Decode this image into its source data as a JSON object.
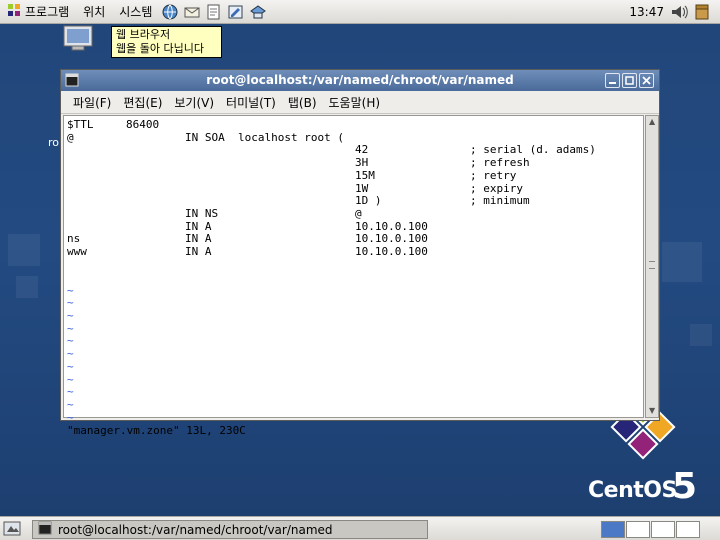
{
  "top_panel": {
    "menus": [
      {
        "label": "프로그램",
        "icon": "applications-menu-icon"
      },
      {
        "label": "위치",
        "icon": ""
      },
      {
        "label": "시스템",
        "icon": ""
      }
    ],
    "launchers": [
      "web-browser-launcher-icon",
      "email-launcher-icon",
      "text-editor-launcher-icon",
      "note-launcher-icon",
      "update-launcher-icon"
    ],
    "clock": "13:47",
    "tray_icons": [
      "volume-icon",
      "software-update-icon"
    ]
  },
  "tooltip": {
    "line1": "웹 브라우저",
    "line2": "웹을 돌아 다닙니다"
  },
  "desktop": {
    "label_stub": "ro",
    "logo_word": "CentOS",
    "logo_version": "5"
  },
  "window": {
    "title": "root@localhost:/var/named/chroot/var/named",
    "menubar": [
      "파일(F)",
      "편집(E)",
      "보기(V)",
      "터미널(T)",
      "탭(B)",
      "도움말(H)"
    ],
    "terminal": {
      "lines": [
        [
          "$TTL",
          "86400",
          "",
          "",
          ""
        ],
        [
          "@",
          "",
          "IN SOA  localhost root (",
          "",
          ""
        ],
        [
          "",
          "",
          "",
          "42",
          "; serial (d. adams)"
        ],
        [
          "",
          "",
          "",
          "3H",
          "; refresh"
        ],
        [
          "",
          "",
          "",
          "15M",
          "; retry"
        ],
        [
          "",
          "",
          "",
          "1W",
          "; expiry"
        ],
        [
          "",
          "",
          "",
          "1D )",
          "; minimum"
        ],
        [
          "",
          "",
          "IN NS",
          "@",
          ""
        ],
        [
          "",
          "",
          "IN A",
          "10.10.0.100",
          ""
        ],
        [
          "ns",
          "",
          "IN A",
          "10.10.0.100",
          ""
        ],
        [
          "www",
          "",
          "IN A",
          "10.10.0.100",
          ""
        ]
      ],
      "tilde": "~",
      "tilde_count": 11,
      "status": "\"manager.vm.zone\" 13L, 230C"
    }
  },
  "bottom_panel": {
    "task_label": "root@localhost:/var/named/chroot/var/named",
    "workspaces": 4,
    "active_workspace": 1
  },
  "colors": {
    "desktop_blue": "#21467a",
    "titlebar_blue": "#5a7aaa",
    "tooltip_yellow": "#ffffbf",
    "tilde_blue": "#3a5fd8"
  }
}
